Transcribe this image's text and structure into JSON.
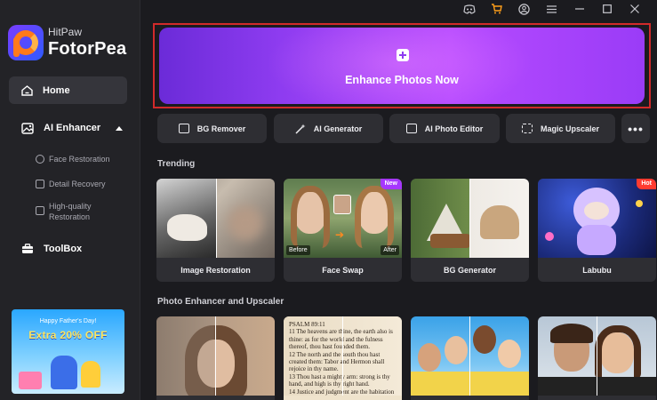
{
  "brand": {
    "small": "HitPaw",
    "big": "FotorPea"
  },
  "nav": {
    "home": "Home",
    "ai_enhancer": "AI Enhancer",
    "sub_items": [
      "Face Restoration",
      "Detail Recovery",
      "High-quality Restoration"
    ],
    "toolbox": "ToolBox"
  },
  "promo": {
    "top": "Happy Father's Day!",
    "main": "Extra 20% OFF"
  },
  "hero": {
    "label": "Enhance Photos Now"
  },
  "tools": [
    "BG Remover",
    "AI Generator",
    "AI Photo Editor",
    "Magic Upscaler"
  ],
  "more": "•••",
  "sections": {
    "trending": "Trending",
    "enhancer": "Photo Enhancer and Upscaler"
  },
  "trending_cards": [
    {
      "label": "Image Restoration"
    },
    {
      "label": "Face Swap",
      "badge": "New",
      "before": "Before",
      "after": "After"
    },
    {
      "label": "BG Generator"
    },
    {
      "label": "Labubu",
      "badge": "Hot"
    }
  ],
  "book_text": "PSALM 89:11\n11 The heavens are thine, the earth also is thine: as for the world and the fulness thereof, thou hast founded them.\n12 The north and the south thou hast created them: Tabor and Hermon shall rejoice in thy name.\n13 Thou hast a mighty arm: strong is thy hand, and high is thy right hand.\n14 Justice and judgment are the habitation of thy throne: mercy and truth shall go before thy face.",
  "colors": {
    "accent": "#8e3cf0",
    "highlight_border": "#d12a2a",
    "badge_new": "#a637ff",
    "badge_hot": "#ff3b30"
  }
}
